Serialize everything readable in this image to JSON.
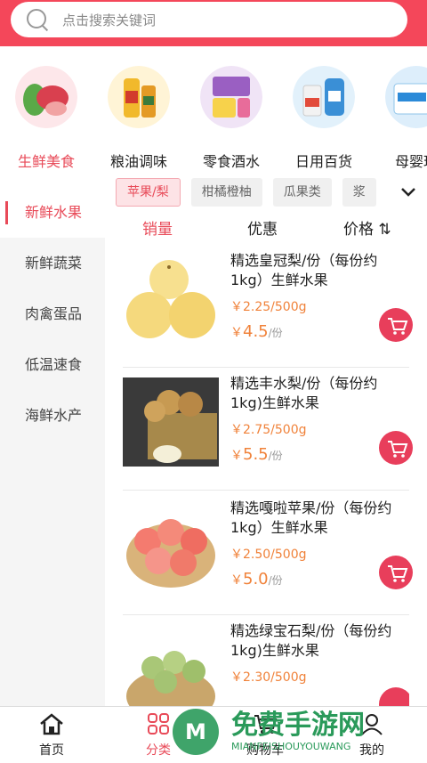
{
  "search": {
    "placeholder": "点击搜索关键词"
  },
  "categories": [
    {
      "label": "生鲜美食",
      "icon": "fresh-food-icon"
    },
    {
      "label": "粮油调味",
      "icon": "grain-oil-icon"
    },
    {
      "label": "零食酒水",
      "icon": "snacks-icon"
    },
    {
      "label": "日用百货",
      "icon": "daily-goods-icon"
    },
    {
      "label": "母婴玩",
      "icon": "baby-products-icon"
    }
  ],
  "sidebar": {
    "items": [
      {
        "label": "新鲜水果"
      },
      {
        "label": "新鲜蔬菜"
      },
      {
        "label": "肉禽蛋品"
      },
      {
        "label": "低温速食"
      },
      {
        "label": "海鲜水产"
      }
    ]
  },
  "subtabs": [
    {
      "label": "苹果/梨"
    },
    {
      "label": "柑橘橙柚"
    },
    {
      "label": "瓜果类"
    },
    {
      "label": "浆"
    }
  ],
  "sort": {
    "sales": "销量",
    "discount": "优惠",
    "price": "价格 ⇅"
  },
  "products": [
    {
      "name": "精选皇冠梨/份（每份约1kg）生鲜水果",
      "unit_price": "￥2.25/500g",
      "price_symbol": "￥",
      "price_main": "4.5",
      "price_unit": "/份"
    },
    {
      "name": "精选丰水梨/份（每份约1kg)生鲜水果",
      "unit_price": "￥2.75/500g",
      "price_symbol": "￥",
      "price_main": "5.5",
      "price_unit": "/份"
    },
    {
      "name": "精选嘎啦苹果/份（每份约1kg）生鲜水果",
      "unit_price": "￥2.50/500g",
      "price_symbol": "￥",
      "price_main": "5.0",
      "price_unit": "/份"
    },
    {
      "name": "精选绿宝石梨/份（每份约1kg)生鲜水果",
      "unit_price": "￥2.30/500g",
      "price_symbol": "",
      "price_main": "",
      "price_unit": ""
    }
  ],
  "tabbar": [
    {
      "label": "首页",
      "icon": "home-icon"
    },
    {
      "label": "分类",
      "icon": "category-icon"
    },
    {
      "label": "购物车",
      "icon": "cart-icon"
    },
    {
      "label": "我的",
      "icon": "user-icon"
    }
  ],
  "watermark": {
    "title": "免费手游网",
    "sub": "MIANFEISHOUYOUWANG"
  },
  "colors": {
    "brand": "#f4475a",
    "accent": "#e84a58",
    "price": "#f0823a"
  }
}
